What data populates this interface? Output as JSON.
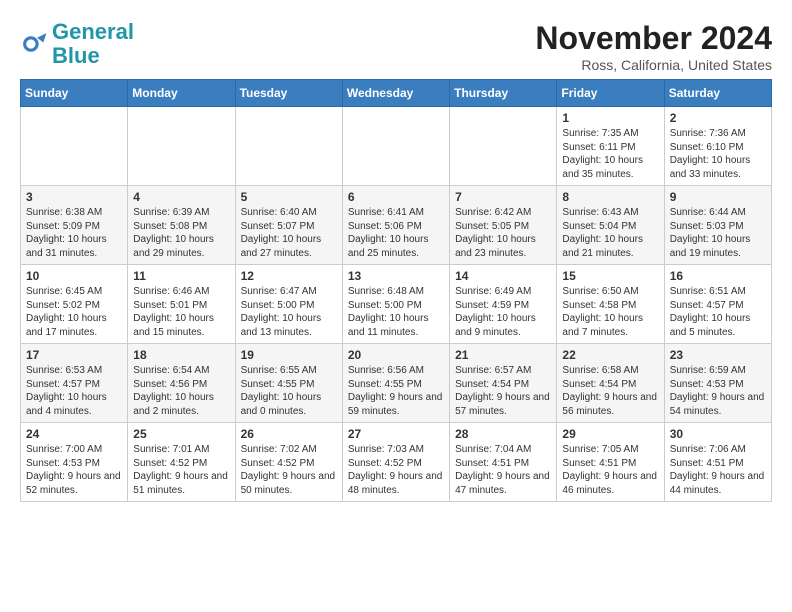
{
  "header": {
    "logo_line1": "General",
    "logo_line2": "Blue",
    "title": "November 2024",
    "subtitle": "Ross, California, United States"
  },
  "weekdays": [
    "Sunday",
    "Monday",
    "Tuesday",
    "Wednesday",
    "Thursday",
    "Friday",
    "Saturday"
  ],
  "weeks": [
    [
      {
        "day": "",
        "info": ""
      },
      {
        "day": "",
        "info": ""
      },
      {
        "day": "",
        "info": ""
      },
      {
        "day": "",
        "info": ""
      },
      {
        "day": "",
        "info": ""
      },
      {
        "day": "1",
        "info": "Sunrise: 7:35 AM\nSunset: 6:11 PM\nDaylight: 10 hours and 35 minutes."
      },
      {
        "day": "2",
        "info": "Sunrise: 7:36 AM\nSunset: 6:10 PM\nDaylight: 10 hours and 33 minutes."
      }
    ],
    [
      {
        "day": "3",
        "info": "Sunrise: 6:38 AM\nSunset: 5:09 PM\nDaylight: 10 hours and 31 minutes."
      },
      {
        "day": "4",
        "info": "Sunrise: 6:39 AM\nSunset: 5:08 PM\nDaylight: 10 hours and 29 minutes."
      },
      {
        "day": "5",
        "info": "Sunrise: 6:40 AM\nSunset: 5:07 PM\nDaylight: 10 hours and 27 minutes."
      },
      {
        "day": "6",
        "info": "Sunrise: 6:41 AM\nSunset: 5:06 PM\nDaylight: 10 hours and 25 minutes."
      },
      {
        "day": "7",
        "info": "Sunrise: 6:42 AM\nSunset: 5:05 PM\nDaylight: 10 hours and 23 minutes."
      },
      {
        "day": "8",
        "info": "Sunrise: 6:43 AM\nSunset: 5:04 PM\nDaylight: 10 hours and 21 minutes."
      },
      {
        "day": "9",
        "info": "Sunrise: 6:44 AM\nSunset: 5:03 PM\nDaylight: 10 hours and 19 minutes."
      }
    ],
    [
      {
        "day": "10",
        "info": "Sunrise: 6:45 AM\nSunset: 5:02 PM\nDaylight: 10 hours and 17 minutes."
      },
      {
        "day": "11",
        "info": "Sunrise: 6:46 AM\nSunset: 5:01 PM\nDaylight: 10 hours and 15 minutes."
      },
      {
        "day": "12",
        "info": "Sunrise: 6:47 AM\nSunset: 5:00 PM\nDaylight: 10 hours and 13 minutes."
      },
      {
        "day": "13",
        "info": "Sunrise: 6:48 AM\nSunset: 5:00 PM\nDaylight: 10 hours and 11 minutes."
      },
      {
        "day": "14",
        "info": "Sunrise: 6:49 AM\nSunset: 4:59 PM\nDaylight: 10 hours and 9 minutes."
      },
      {
        "day": "15",
        "info": "Sunrise: 6:50 AM\nSunset: 4:58 PM\nDaylight: 10 hours and 7 minutes."
      },
      {
        "day": "16",
        "info": "Sunrise: 6:51 AM\nSunset: 4:57 PM\nDaylight: 10 hours and 5 minutes."
      }
    ],
    [
      {
        "day": "17",
        "info": "Sunrise: 6:53 AM\nSunset: 4:57 PM\nDaylight: 10 hours and 4 minutes."
      },
      {
        "day": "18",
        "info": "Sunrise: 6:54 AM\nSunset: 4:56 PM\nDaylight: 10 hours and 2 minutes."
      },
      {
        "day": "19",
        "info": "Sunrise: 6:55 AM\nSunset: 4:55 PM\nDaylight: 10 hours and 0 minutes."
      },
      {
        "day": "20",
        "info": "Sunrise: 6:56 AM\nSunset: 4:55 PM\nDaylight: 9 hours and 59 minutes."
      },
      {
        "day": "21",
        "info": "Sunrise: 6:57 AM\nSunset: 4:54 PM\nDaylight: 9 hours and 57 minutes."
      },
      {
        "day": "22",
        "info": "Sunrise: 6:58 AM\nSunset: 4:54 PM\nDaylight: 9 hours and 56 minutes."
      },
      {
        "day": "23",
        "info": "Sunrise: 6:59 AM\nSunset: 4:53 PM\nDaylight: 9 hours and 54 minutes."
      }
    ],
    [
      {
        "day": "24",
        "info": "Sunrise: 7:00 AM\nSunset: 4:53 PM\nDaylight: 9 hours and 52 minutes."
      },
      {
        "day": "25",
        "info": "Sunrise: 7:01 AM\nSunset: 4:52 PM\nDaylight: 9 hours and 51 minutes."
      },
      {
        "day": "26",
        "info": "Sunrise: 7:02 AM\nSunset: 4:52 PM\nDaylight: 9 hours and 50 minutes."
      },
      {
        "day": "27",
        "info": "Sunrise: 7:03 AM\nSunset: 4:52 PM\nDaylight: 9 hours and 48 minutes."
      },
      {
        "day": "28",
        "info": "Sunrise: 7:04 AM\nSunset: 4:51 PM\nDaylight: 9 hours and 47 minutes."
      },
      {
        "day": "29",
        "info": "Sunrise: 7:05 AM\nSunset: 4:51 PM\nDaylight: 9 hours and 46 minutes."
      },
      {
        "day": "30",
        "info": "Sunrise: 7:06 AM\nSunset: 4:51 PM\nDaylight: 9 hours and 44 minutes."
      }
    ]
  ]
}
